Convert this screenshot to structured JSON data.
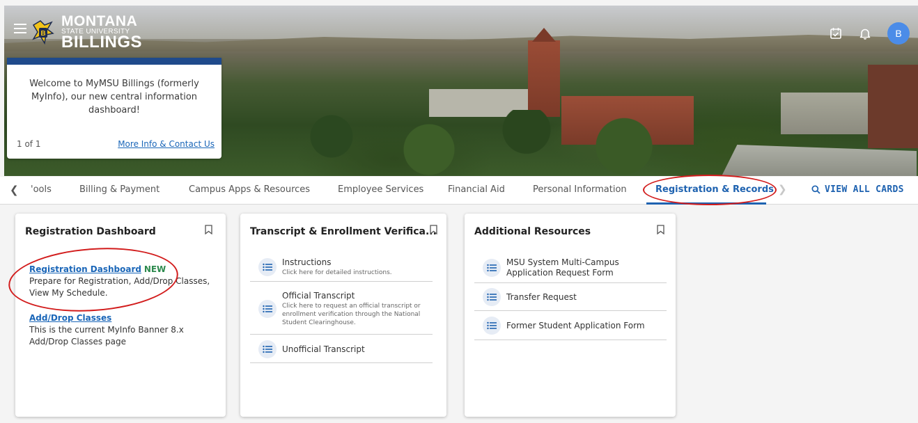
{
  "header": {
    "logo": {
      "line1": "MONTANA",
      "line2": "STATE UNIVERSITY",
      "line3": "BILLINGS"
    },
    "avatar_initial": "B"
  },
  "announcement": {
    "message": "Welcome to MyMSU Billings (formerly MyInfo), our new central information dashboard!",
    "pager": "1 of 1",
    "link": "More Info & Contact Us"
  },
  "tabs": {
    "items": [
      "'ools",
      "Billing & Payment",
      "Campus Apps & Resources",
      "Employee Services",
      "Financial Aid",
      "Personal Information",
      "Registration & Records"
    ],
    "active": "Registration & Records",
    "view_all": "VIEW ALL CARDS"
  },
  "cards": {
    "registration": {
      "title": "Registration Dashboard",
      "items": [
        {
          "link": "Registration Dashboard",
          "badge": "NEW",
          "description": "Prepare for Registration, Add/Drop Classes, View My Schedule."
        },
        {
          "link": "Add/Drop Classes",
          "badge": "",
          "description": "This is the current MyInfo Banner 8.x Add/Drop Classes page"
        }
      ]
    },
    "transcript": {
      "title": "Transcript & Enrollment Verifica...",
      "items": [
        {
          "title": "Instructions",
          "subtitle": "Click here for detailed instructions."
        },
        {
          "title": "Official Transcript",
          "subtitle": "Click here to request an official transcript or enrollment verification through the National Student Clearinghouse."
        },
        {
          "title": "Unofficial Transcript",
          "subtitle": ""
        }
      ]
    },
    "resources": {
      "title": "Additional Resources",
      "items": [
        {
          "title": "MSU System Multi-Campus Application Request Form"
        },
        {
          "title": "Transfer Request"
        },
        {
          "title": "Former Student Application Form"
        }
      ]
    }
  },
  "colors": {
    "accent": "#1e62b0",
    "link": "#1a66b8",
    "new_badge": "#2d8a4e",
    "announcement_bar": "#1f4a8b",
    "annotation": "#d21c1c",
    "avatar": "#4b8ce8"
  }
}
